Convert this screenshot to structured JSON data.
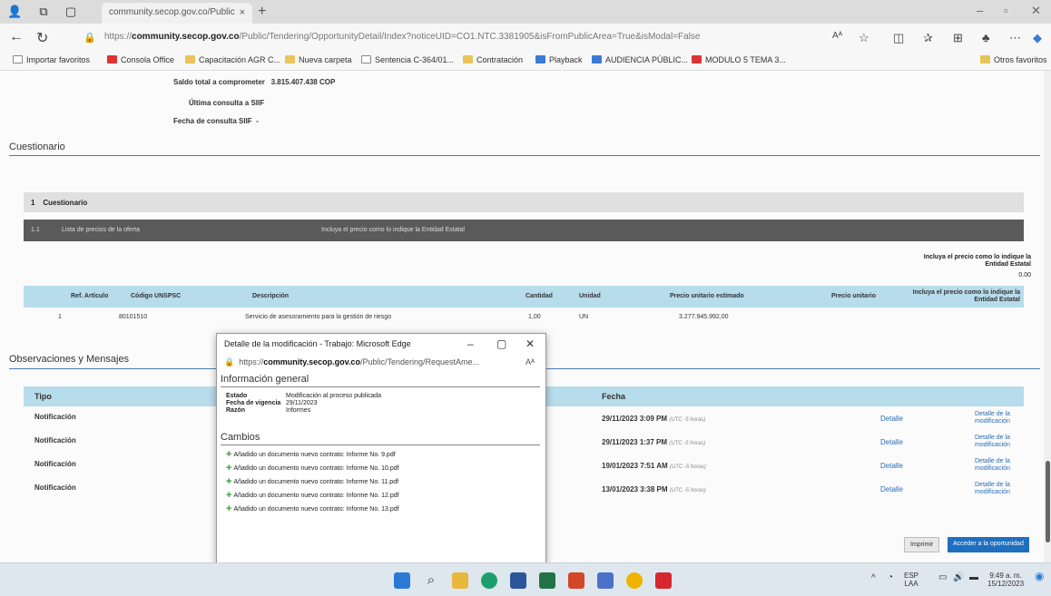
{
  "browser": {
    "tab_title": "community.secop.gov.co/Public",
    "tab_close": "×",
    "new_tab": "+",
    "url_prefix": "https://",
    "url_domain": "community.secop.gov.co",
    "url_path": "/Public/Tendering/OpportunityDetail/Index?noticeUID=CO1.NTC.3381905&isFromPublicArea=True&isModal=False",
    "read_aloud": "Aᴬ",
    "favorites": [
      "Importar favoritos",
      "Consola Office",
      "Capacitación AGR C...",
      "Nueva carpeta",
      "Sentencia C-364/01...",
      "Contratación",
      "Playback",
      "AUDIENCIA PÚBLIC...",
      "MODULO 5 TEMA 3..."
    ],
    "other_favorites": "Otros favoritos"
  },
  "sbif": {
    "saldo_label": "Saldo total a comprometer",
    "saldo_value": "3.815.407.438 COP",
    "ultima_label": "Última consulta a SIIF",
    "fecha_label": "Fecha de consulta SIIF",
    "fecha_value": "-"
  },
  "cuestionario": {
    "title": "Cuestionario",
    "header_num": "1",
    "header_label": "Cuestionario",
    "row_num": "1.1",
    "row_label": "Lista de precios de la oferta",
    "row_instruction": "Incluya el precio como lo indique la Entidad Estatal",
    "right_note": "Incluya el precio como lo indique la Entidad Estatal",
    "total": "0.00",
    "columns": [
      "Ref. Artículo",
      "Código UNSPSC",
      "Descripción",
      "Cantidad",
      "Unidad",
      "Precio unitario estimado",
      "Precio unitario",
      "Incluya el precio como lo indique la Entidad Estatal"
    ],
    "row": {
      "ref": "1",
      "code": "80101510",
      "desc": "Servicio de asesoramiento para la gestión de riesgo",
      "qty": "1,00",
      "unit": "UN",
      "est": "3.277.945.992,00"
    }
  },
  "observaciones": {
    "title": "Observaciones y Mensajes",
    "col_tipo": "Tipo",
    "col_fecha": "Fecha",
    "rows": [
      {
        "tipo": "Notificación",
        "fecha": "29/11/2023 3:09 PM",
        "tz": "(UTC -5 horas)",
        "detalle": "Detalle",
        "detmod": "Detalle de la modificación"
      },
      {
        "tipo": "Notificación",
        "fecha": "29/11/2023 1:37 PM",
        "tz": "(UTC -5 horas)",
        "detalle": "Detalle",
        "detmod": "Detalle de la modificación"
      },
      {
        "tipo": "Notificación",
        "fecha": "19/01/2023 7:51 AM",
        "tz": "(UTC -5 horas)",
        "detalle": "Detalle",
        "detmod": "Detalle de la modificación"
      },
      {
        "tipo": "Notificación",
        "fecha": "13/01/2023 3:38 PM",
        "tz": "(UTC -5 horas)",
        "detalle": "Detalle",
        "detmod": "Detalle de la modificación"
      }
    ],
    "btn_print": "Imprimir",
    "btn_access": "Acceder a la oportunidad"
  },
  "popup": {
    "title": "Detalle de la modificación - Trabajo: Microsoft Edge",
    "url_prefix": "https://",
    "url_domain": "community.secop.gov.co",
    "url_path": "/Public/Tendering/RequestAme...",
    "read_aloud": "Aᴬ",
    "info_title": "Información general",
    "estado_label": "Estado",
    "estado_value": "Modificación al proceso publicada",
    "vigencia_label": "Fecha de vigencia",
    "vigencia_value": "29/11/2023",
    "razon_label": "Razón",
    "razon_value": "Informes",
    "cambios_title": "Cambios",
    "changes": [
      "Añadido un documento nuevo contrato: Informe No. 9.pdf",
      "Añadido un documento nuevo contrato: Informe No. 10.pdf",
      "Añadido un documento nuevo contrato: Informe No. 11.pdf",
      "Añadido un documento nuevo contrato: Informe No. 12.pdf",
      "Añadido un documento nuevo contrato: Informe No. 13.pdf"
    ]
  },
  "taskbar": {
    "lang1": "ESP",
    "lang2": "LAA",
    "time": "9:49 a. m.",
    "date": "15/12/2023"
  },
  "colors": {
    "accent": "#1f6fbf",
    "table_header": "#b7dcec",
    "dark_row": "#5a5a5a"
  }
}
